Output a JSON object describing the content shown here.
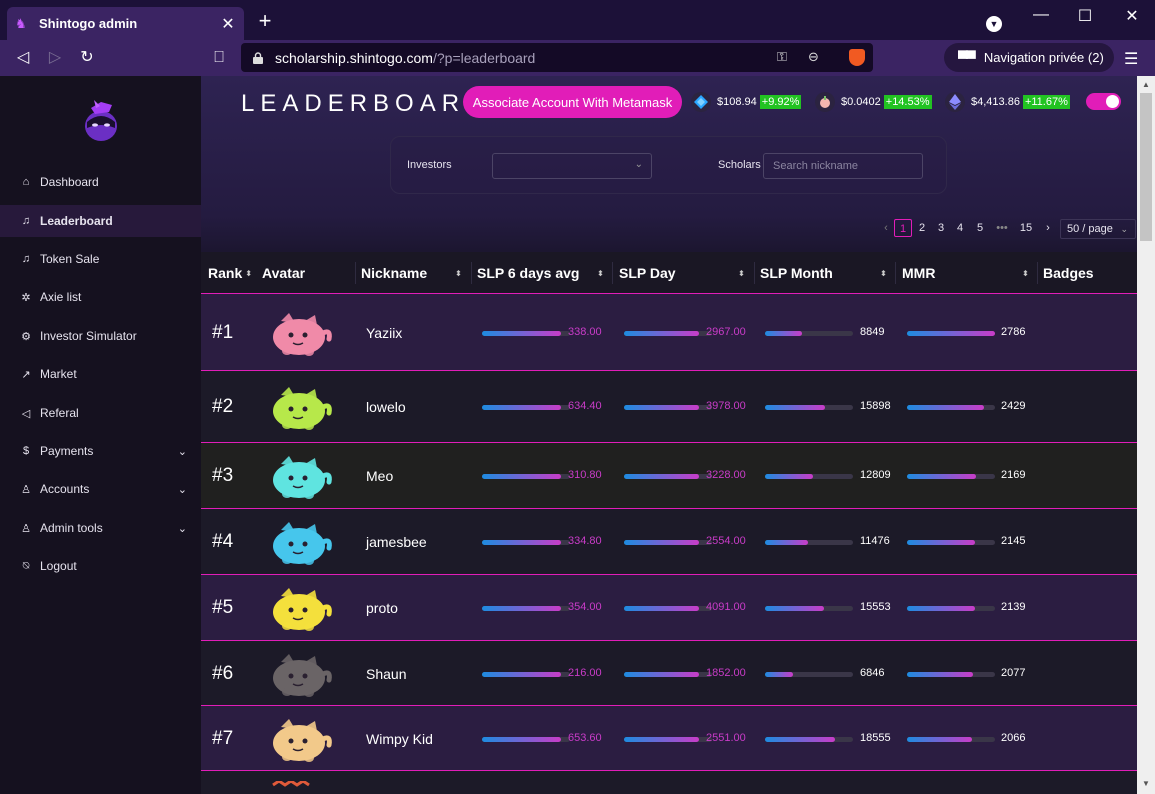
{
  "browser": {
    "tab_title": "Shintogo admin",
    "url_host": "scholarship.shintogo.com",
    "url_path": "/?p=leaderboard",
    "private_label": "Navigation privée (2)"
  },
  "sidebar": {
    "items": [
      {
        "label": "Dashboard",
        "icon": "home-icon"
      },
      {
        "label": "Leaderboard",
        "icon": "bell-icon"
      },
      {
        "label": "Token Sale",
        "icon": "bell-icon"
      },
      {
        "label": "Axie list",
        "icon": "bug-icon"
      },
      {
        "label": "Investor Simulator",
        "icon": "gear-icon"
      },
      {
        "label": "Market",
        "icon": "chart-line-icon"
      },
      {
        "label": "Referal",
        "icon": "megaphone-icon"
      },
      {
        "label": "Payments",
        "icon": "dollar-icon"
      },
      {
        "label": "Accounts",
        "icon": "user-icon"
      },
      {
        "label": "Admin tools",
        "icon": "user-icon"
      },
      {
        "label": "Logout",
        "icon": "logout-icon"
      }
    ],
    "active_index": 1
  },
  "header": {
    "title": "LEADERBOARD",
    "metamask_button": "Associate Account With Metamask",
    "tokens": [
      {
        "price": "$108.94",
        "change": "+9.92%",
        "icon": "axs-icon"
      },
      {
        "price": "$0.0402",
        "change": "+14.53%",
        "icon": "slp-icon"
      },
      {
        "price": "$4,413.86",
        "change": "+11.67%",
        "icon": "eth-icon"
      }
    ]
  },
  "filters": {
    "investors_label": "Investors",
    "scholars_label": "Scholars",
    "search_placeholder": "Search nickname"
  },
  "pagination": {
    "pages": [
      "1",
      "2",
      "3",
      "4",
      "5",
      "•••",
      "15"
    ],
    "current": "1",
    "per_page": "50 / page"
  },
  "table": {
    "columns": [
      "Rank",
      "Avatar",
      "Nickname",
      "SLP 6 days avg",
      "SLP Day",
      "SLP Month",
      "MMR",
      "Badges"
    ],
    "rows": [
      {
        "rank": "#1",
        "nickname": "Yaziix",
        "slp6": "338.00",
        "slp6_frac": 0.9,
        "day": "2967.00",
        "day_frac": 0.85,
        "month": "8849",
        "month_frac": 0.42,
        "mmr": "2786",
        "mmr_frac": 1.0,
        "avatar_color": "#f08aa8"
      },
      {
        "rank": "#2",
        "nickname": "lowelo",
        "slp6": "634.40",
        "slp6_frac": 0.9,
        "day": "3978.00",
        "day_frac": 0.85,
        "month": "15898",
        "month_frac": 0.68,
        "mmr": "2429",
        "mmr_frac": 0.88,
        "avatar_color": "#b7e84a"
      },
      {
        "rank": "#3",
        "nickname": "Meo",
        "slp6": "310.80",
        "slp6_frac": 0.9,
        "day": "3228.00",
        "day_frac": 0.85,
        "month": "12809",
        "month_frac": 0.55,
        "mmr": "2169",
        "mmr_frac": 0.78,
        "avatar_color": "#5fe4e0"
      },
      {
        "rank": "#4",
        "nickname": "jamesbee",
        "slp6": "334.80",
        "slp6_frac": 0.9,
        "day": "2554.00",
        "day_frac": 0.85,
        "month": "11476",
        "month_frac": 0.49,
        "mmr": "2145",
        "mmr_frac": 0.77,
        "avatar_color": "#46c6ec"
      },
      {
        "rank": "#5",
        "nickname": "proto",
        "slp6": "354.00",
        "slp6_frac": 0.9,
        "day": "4091.00",
        "day_frac": 0.85,
        "month": "15553",
        "month_frac": 0.67,
        "mmr": "2139",
        "mmr_frac": 0.77,
        "avatar_color": "#f4e03c"
      },
      {
        "rank": "#6",
        "nickname": "Shaun",
        "slp6": "216.00",
        "slp6_frac": 0.9,
        "day": "1852.00",
        "day_frac": 0.85,
        "month": "6846",
        "month_frac": 0.32,
        "mmr": "2077",
        "mmr_frac": 0.75,
        "avatar_color": "#6a6466"
      },
      {
        "rank": "#7",
        "nickname": "Wimpy Kid",
        "slp6": "653.60",
        "slp6_frac": 0.9,
        "day": "2551.00",
        "day_frac": 0.85,
        "month": "18555",
        "month_frac": 0.8,
        "mmr": "2066",
        "mmr_frac": 0.74,
        "avatar_color": "#f2c98a"
      }
    ]
  }
}
